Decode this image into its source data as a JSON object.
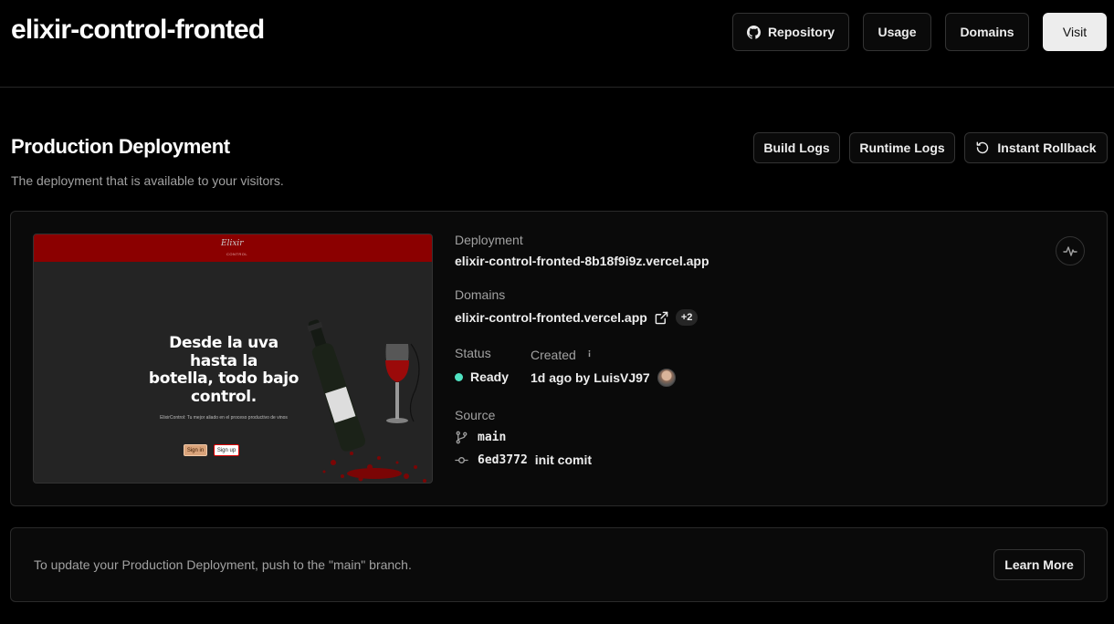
{
  "header": {
    "title": "elixir-control-fronted",
    "repository_label": "Repository",
    "usage_label": "Usage",
    "domains_label": "Domains",
    "visit_label": "Visit"
  },
  "section": {
    "title": "Production Deployment",
    "description": "The deployment that is available to your visitors.",
    "build_logs_label": "Build Logs",
    "runtime_logs_label": "Runtime Logs",
    "rollback_label": "Instant Rollback"
  },
  "preview": {
    "logo_text": "Elixir",
    "logo_sub": "CONTROL",
    "heading_line1": "Desde la uva",
    "heading_line2": "hasta la",
    "heading_line3": "botella, todo bajo",
    "heading_line4": "control.",
    "subtext": "ElixirControl: Tu mejor aliado en el proceso productivo de vinos",
    "signin_label": "Sign in",
    "signup_label": "Sign up"
  },
  "deployment": {
    "deployment_label": "Deployment",
    "deployment_url": "elixir-control-fronted-8b18f9i9z.vercel.app",
    "domains_label": "Domains",
    "domain_url": "elixir-control-fronted.vercel.app",
    "extra_domains": "+2",
    "status_label": "Status",
    "status_value": "Ready",
    "status_color": "#50e3c2",
    "created_label": "Created",
    "created_value": "1d ago by LuisVJ97",
    "source_label": "Source",
    "branch": "main",
    "commit_hash": "6ed3772",
    "commit_message": "init comit"
  },
  "footer": {
    "message": "To update your Production Deployment, push to the \"main\" branch.",
    "learn_more_label": "Learn More"
  }
}
